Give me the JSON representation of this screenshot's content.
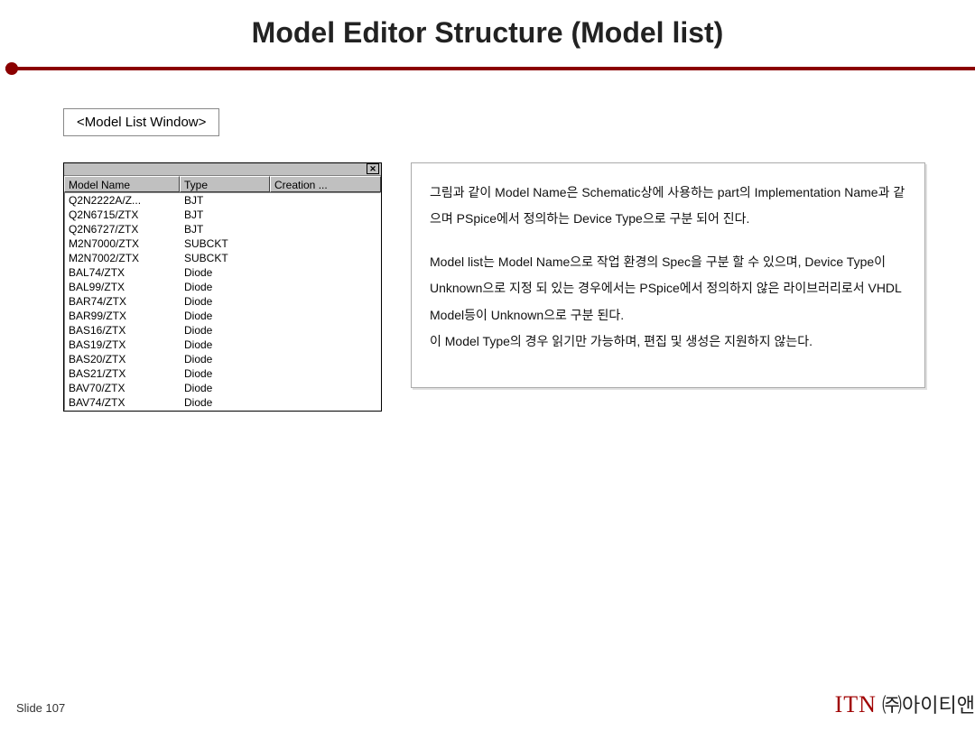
{
  "title": "Model Editor Structure (Model list)",
  "label": "<Model List Window>",
  "window": {
    "close": "✕",
    "headers": {
      "c1": "Model Name",
      "c2": "Type",
      "c3": "Creation ..."
    },
    "rows": [
      {
        "name": "Q2N2222A/Z...",
        "type": "BJT",
        "creation": ""
      },
      {
        "name": "Q2N6715/ZTX",
        "type": "BJT",
        "creation": ""
      },
      {
        "name": "Q2N6727/ZTX",
        "type": "BJT",
        "creation": ""
      },
      {
        "name": "M2N7000/ZTX",
        "type": "SUBCKT",
        "creation": ""
      },
      {
        "name": "M2N7002/ZTX",
        "type": "SUBCKT",
        "creation": ""
      },
      {
        "name": "BAL74/ZTX",
        "type": "Diode",
        "creation": ""
      },
      {
        "name": "BAL99/ZTX",
        "type": "Diode",
        "creation": ""
      },
      {
        "name": "BAR74/ZTX",
        "type": "Diode",
        "creation": ""
      },
      {
        "name": "BAR99/ZTX",
        "type": "Diode",
        "creation": ""
      },
      {
        "name": "BAS16/ZTX",
        "type": "Diode",
        "creation": ""
      },
      {
        "name": "BAS19/ZTX",
        "type": "Diode",
        "creation": ""
      },
      {
        "name": "BAS20/ZTX",
        "type": "Diode",
        "creation": ""
      },
      {
        "name": "BAS21/ZTX",
        "type": "Diode",
        "creation": ""
      },
      {
        "name": "BAV70/ZTX",
        "type": "Diode",
        "creation": ""
      },
      {
        "name": "BAV74/ZTX",
        "type": "Diode",
        "creation": ""
      }
    ]
  },
  "description": {
    "p1": "그림과 같이 Model Name은 Schematic상에 사용하는 part의 Implementation Name과 같으며 PSpice에서 정의하는 Device Type으로 구분 되어 진다.",
    "p2": "Model list는 Model Name으로 작업 환경의 Spec을 구분 할 수 있으며, Device Type이 Unknown으로 지정 되 있는 경우에서는 PSpice에서 정의하지 않은 라이브러리로서 VHDL Model등이 Unknown으로 구분 된다.\n이 Model Type의 경우 읽기만 가능하며, 편집 및 생성은 지원하지 않는다."
  },
  "footer": {
    "slide": "Slide 107",
    "brand_itn": "ITN",
    "brand_rest": " ㈜아이티앤"
  }
}
